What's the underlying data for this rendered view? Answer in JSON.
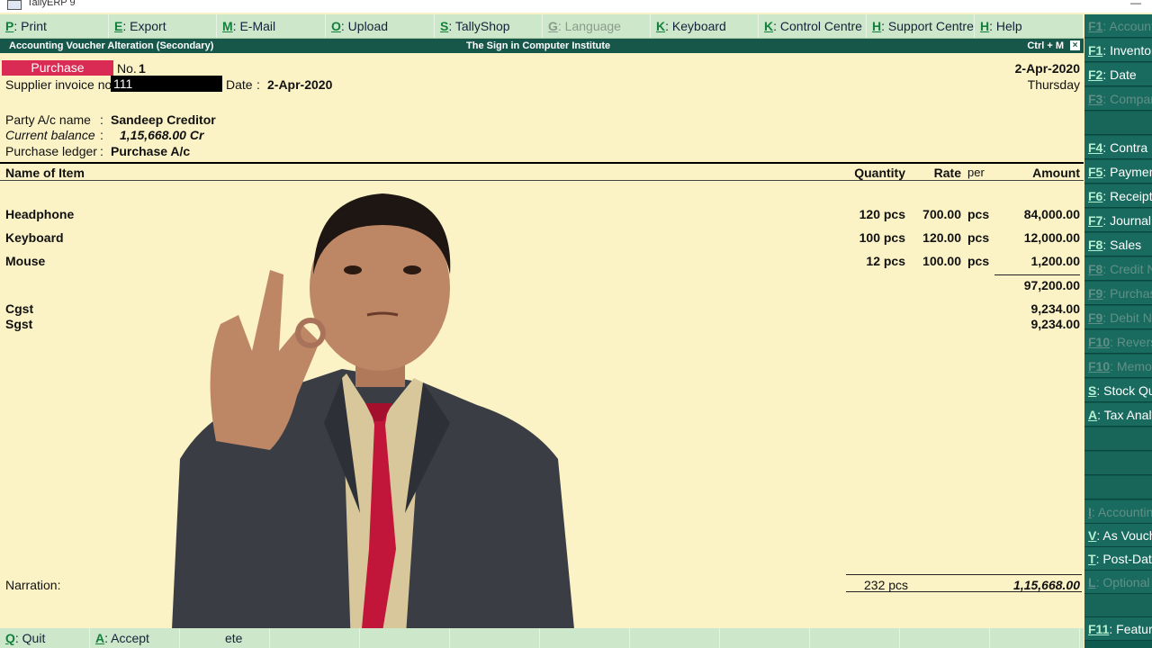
{
  "window": {
    "title": "TallyERP 9",
    "minimize": "—"
  },
  "menubar": [
    {
      "key": "P",
      "label": ": Print",
      "disabled": false
    },
    {
      "key": "E",
      "label": ": Export",
      "disabled": false
    },
    {
      "key": "M",
      "label": ": E-Mail",
      "disabled": false
    },
    {
      "key": "O",
      "label": ": Upload",
      "disabled": false
    },
    {
      "key": "S",
      "label": ": TallyShop",
      "disabled": false
    },
    {
      "key": "G",
      "label": ": Language",
      "disabled": true
    },
    {
      "key": "K",
      "label": ": Keyboard",
      "disabled": false
    },
    {
      "key": "K",
      "label": ": Control Centre",
      "disabled": false
    },
    {
      "key": "H",
      "label": ": Support Centre",
      "disabled": false
    },
    {
      "key": "H",
      "label": ": Help",
      "disabled": false
    }
  ],
  "voucher_bar": {
    "left": "Accounting Voucher  Alteration  (Secondary)",
    "center": "The Sign in Computer Institute",
    "shortcut": "Ctrl + M",
    "close": "×"
  },
  "voucher": {
    "type": "Purchase",
    "no_label": "No.",
    "no_value": "1",
    "date_top": "2-Apr-2020",
    "day": "Thursday",
    "supplier_invoice_label": "Supplier invoice no.:",
    "supplier_invoice_value": "111",
    "date_label": "Date",
    "date_colon": ":",
    "date_value": "2-Apr-2020",
    "party_label": "Party A/c name",
    "party_value": "Sandeep Creditor",
    "balance_label": "Current balance",
    "balance_value": "1,15,668.00 Cr",
    "ledger_label": "Purchase ledger",
    "ledger_value": "Purchase A/c",
    "colon": ":"
  },
  "table": {
    "headers": {
      "item": "Name of Item",
      "quantity": "Quantity",
      "rate": "Rate",
      "per": "per",
      "amount": "Amount"
    },
    "rows": [
      {
        "item": "Headphone",
        "quantity": "120 pcs",
        "rate": "700.00",
        "per": "pcs",
        "amount": "84,000.00"
      },
      {
        "item": "Keyboard",
        "quantity": "100 pcs",
        "rate": "120.00",
        "per": "pcs",
        "amount": "12,000.00"
      },
      {
        "item": "Mouse",
        "quantity": "12 pcs",
        "rate": "100.00",
        "per": "pcs",
        "amount": "1,200.00"
      }
    ],
    "subtotal": "97,200.00",
    "taxes": [
      {
        "name": "Cgst",
        "amount": "9,234.00"
      },
      {
        "name": "Sgst",
        "amount": "9,234.00"
      }
    ]
  },
  "narration_label": "Narration:",
  "totals": {
    "quantity": "232 pcs",
    "amount": "1,15,668.00"
  },
  "right_panel": [
    {
      "key": "F1",
      "label": ": Accounting",
      "dim": true
    },
    {
      "key": "F1",
      "label": ": Inventory V",
      "dim": false
    },
    {
      "key": "F2",
      "label": ": Date",
      "dim": false
    },
    {
      "key": "F3",
      "label": ": Company",
      "dim": true
    },
    {
      "key": "",
      "label": "",
      "dim": false
    },
    {
      "key": "F4",
      "label": ": Contra",
      "dim": false
    },
    {
      "key": "F5",
      "label": ": Payment",
      "dim": false
    },
    {
      "key": "F6",
      "label": ": Receipt",
      "dim": false
    },
    {
      "key": "F7",
      "label": ": Journal",
      "dim": false
    },
    {
      "key": "F8",
      "label": ": Sales",
      "dim": false
    },
    {
      "key": "F8",
      "label": ": Credit No",
      "dim": true
    },
    {
      "key": "F9",
      "label": ": Purchase",
      "dim": true
    },
    {
      "key": "F9",
      "label": ": Debit No",
      "dim": true
    },
    {
      "key": "F10",
      "label": ": Reversing",
      "dim": true
    },
    {
      "key": "F10",
      "label": ": Memos",
      "dim": true
    },
    {
      "key": "S",
      "label": ": Stock Qu",
      "dim": false
    },
    {
      "key": "A",
      "label": ": Tax Analy",
      "dim": false
    },
    {
      "key": "",
      "label": "",
      "dim": false
    },
    {
      "key": "",
      "label": "",
      "dim": false
    },
    {
      "key": "",
      "label": "",
      "dim": false
    },
    {
      "key": "I",
      "label": ": Accounting",
      "dim": true
    },
    {
      "key": "V",
      "label": ": As Vouch",
      "dim": false
    },
    {
      "key": "T",
      "label": ": Post-Date",
      "dim": false
    },
    {
      "key": "L",
      "label": ": Optional",
      "dim": true
    },
    {
      "key": "",
      "label": "",
      "dim": false
    },
    {
      "key": "F11",
      "label": ": Feature",
      "dim": false
    }
  ],
  "bottombar": [
    {
      "key": "Q",
      "label": ": Quit"
    },
    {
      "key": "A",
      "label": ": Accept"
    },
    {
      "key": "",
      "label": "ete"
    }
  ],
  "colors": {
    "background": "#fbf3c6",
    "menubar": "#cde7cb",
    "header": "#17574a",
    "voucher_type": "#d92b53",
    "side_panel": "#0f5a4f"
  }
}
